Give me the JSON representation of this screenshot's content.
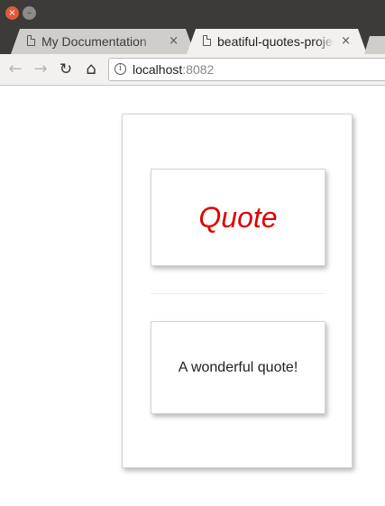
{
  "window": {
    "close_glyph": "×",
    "minimize_glyph": "–"
  },
  "tabs": [
    {
      "title": "My Documentation",
      "close_glyph": "×",
      "active": false,
      "icon": "document-icon"
    },
    {
      "title": "beatiful-quotes-project",
      "close_glyph": "×",
      "active": true,
      "icon": "document-icon"
    }
  ],
  "toolbar": {
    "back_glyph": "←",
    "forward_glyph": "→",
    "reload_glyph": "↻",
    "home_glyph": "⌂",
    "info_glyph": "i",
    "url_host": "localhost",
    "url_port": ":8082"
  },
  "main": {
    "quote_title": "Quote",
    "quote_text": "A wonderful quote!"
  },
  "colors": {
    "quote_title": "#e00000",
    "titlebar": "#3c3b37",
    "close_button": "#e1583a"
  }
}
